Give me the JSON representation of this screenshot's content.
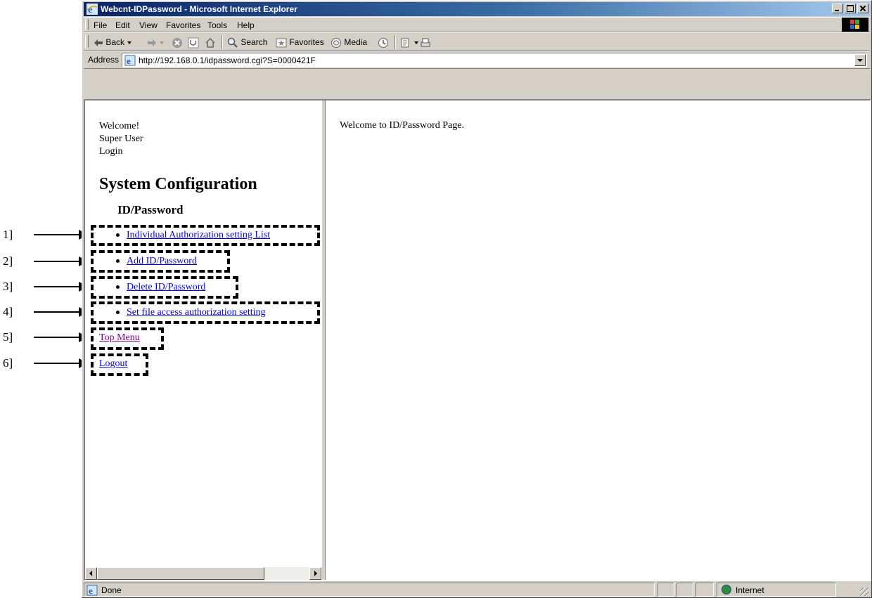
{
  "window": {
    "title": "Webcnt-IDPassword - Microsoft Internet Explorer"
  },
  "menubar": {
    "items": [
      "File",
      "Edit",
      "View",
      "Favorites",
      "Tools",
      "Help"
    ]
  },
  "toolbar": {
    "back": "Back",
    "search": "Search",
    "favorites": "Favorites",
    "media": "Media"
  },
  "address": {
    "label": "Address",
    "url": "http://192.168.0.1/idpassword.cgi?S=0000421F"
  },
  "left_frame": {
    "welcome": "Welcome!",
    "user": "Super User",
    "login": "Login",
    "section_title": "System Configuration",
    "subsection_title": "ID/Password",
    "links": [
      "Individual Authorization setting List",
      "Add ID/Password",
      "Delete ID/Password",
      "Set file access authorization setting"
    ],
    "top_menu": "Top Menu",
    "logout": "Logout"
  },
  "right_frame": {
    "message": "Welcome to ID/Password Page."
  },
  "statusbar": {
    "status": "Done",
    "zone": "Internet"
  },
  "callouts": [
    "1]",
    "2]",
    "3]",
    "4]",
    "5]",
    "6]"
  ],
  "colors": {
    "link": "#0000ee",
    "visited_link": "#800080",
    "title_bar": "#0a246a"
  },
  "icons": [
    "ie-logo-icon",
    "minimize-icon",
    "maximize-icon",
    "close-icon",
    "windows-flag-icon",
    "back-icon",
    "forward-icon",
    "stop-icon",
    "refresh-icon",
    "home-icon",
    "search-icon",
    "favorites-icon",
    "media-icon",
    "history-icon",
    "mail-icon",
    "print-icon",
    "page-icon",
    "globe-icon"
  ]
}
